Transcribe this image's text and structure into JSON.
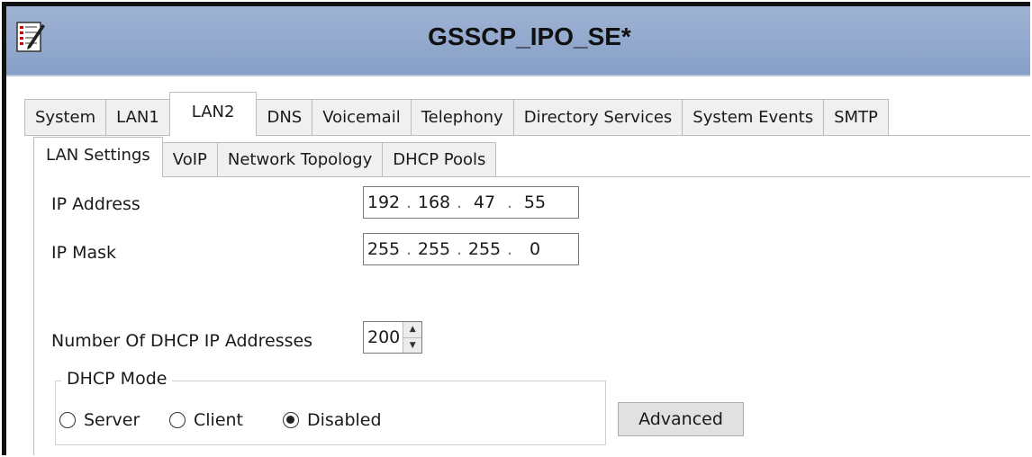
{
  "window": {
    "title": "GSSCP_IPO_SE*",
    "icon": "edit-config-icon"
  },
  "tabs_main": [
    {
      "label": "System",
      "active": false
    },
    {
      "label": "LAN1",
      "active": false
    },
    {
      "label": "LAN2",
      "active": true
    },
    {
      "label": "DNS",
      "active": false
    },
    {
      "label": "Voicemail",
      "active": false
    },
    {
      "label": "Telephony",
      "active": false
    },
    {
      "label": "Directory Services",
      "active": false
    },
    {
      "label": "System Events",
      "active": false
    },
    {
      "label": "SMTP",
      "active": false
    }
  ],
  "tabs_sub": [
    {
      "label": "LAN Settings",
      "active": true
    },
    {
      "label": "VoIP",
      "active": false
    },
    {
      "label": "Network Topology",
      "active": false
    },
    {
      "label": "DHCP Pools",
      "active": false
    }
  ],
  "ip_address": {
    "label": "IP Address",
    "octets": [
      "192",
      "168",
      "47",
      "55"
    ]
  },
  "ip_mask": {
    "label": "IP Mask",
    "octets": [
      "255",
      "255",
      "255",
      "0"
    ]
  },
  "dhcp_count": {
    "label": "Number Of DHCP IP Addresses",
    "value": "200"
  },
  "dhcp_mode": {
    "legend": "DHCP Mode",
    "options": [
      {
        "label": "Server",
        "checked": false
      },
      {
        "label": "Client",
        "checked": false
      },
      {
        "label": "Disabled",
        "checked": true
      }
    ]
  },
  "advanced_button": "Advanced"
}
